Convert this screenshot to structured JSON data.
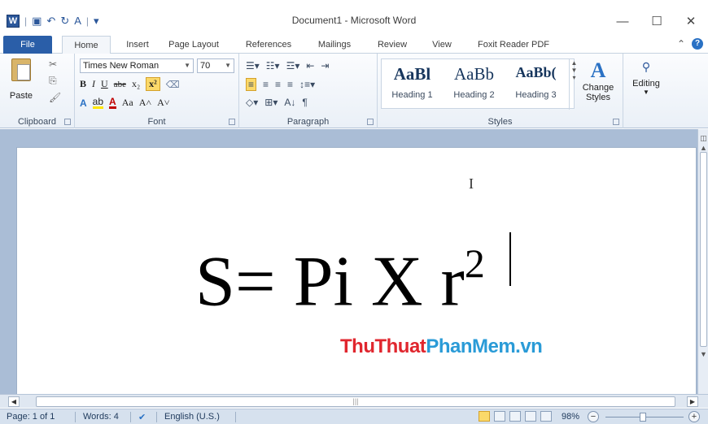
{
  "window": {
    "title": "Document1 - Microsoft Word",
    "app_icon_letter": "W",
    "minimize": "—",
    "maximize": "☐",
    "close": "✕"
  },
  "tabs": [
    {
      "label": "File"
    },
    {
      "label": "Home"
    },
    {
      "label": "Insert"
    },
    {
      "label": "Page Layout"
    },
    {
      "label": "References"
    },
    {
      "label": "Mailings"
    },
    {
      "label": "Review"
    },
    {
      "label": "View"
    },
    {
      "label": "Foxit Reader PDF"
    }
  ],
  "ribbon": {
    "clipboard": {
      "group_label": "Clipboard",
      "paste_label": "Paste"
    },
    "font": {
      "group_label": "Font",
      "font_name": "Times New Roman",
      "font_size": "70",
      "bold": "B",
      "italic": "I",
      "underline": "U",
      "strike": "abe",
      "subscript": "x₂",
      "superscript": "x²",
      "highlight": "ab",
      "font_color": "A",
      "change_case": "Aa",
      "grow": "A˄",
      "shrink": "A˅"
    },
    "paragraph": {
      "group_label": "Paragraph",
      "pilcrow": "¶",
      "sort": "A↓"
    },
    "styles": {
      "group_label": "Styles",
      "items": [
        {
          "sample": "AaBl",
          "name": "Heading 1"
        },
        {
          "sample": "AaBb",
          "name": "Heading 2"
        },
        {
          "sample": "AaBb(",
          "name": "Heading 3"
        }
      ],
      "change_styles_line1": "Change",
      "change_styles_line2": "Styles"
    },
    "editing": {
      "label": "Editing"
    }
  },
  "document": {
    "formula_main": "S= Pi X r",
    "formula_sup": "2",
    "watermark_part1": "ThuThuat",
    "watermark_part2": "PhanMem.vn"
  },
  "statusbar": {
    "page": "Page: 1 of 1",
    "words": "Words: 4",
    "language": "English (U.S.)",
    "zoom": "98%"
  },
  "colors": {
    "file_tab": "#2a5ea8",
    "watermark_red": "#e0262e",
    "watermark_blue": "#2a9bd7"
  }
}
